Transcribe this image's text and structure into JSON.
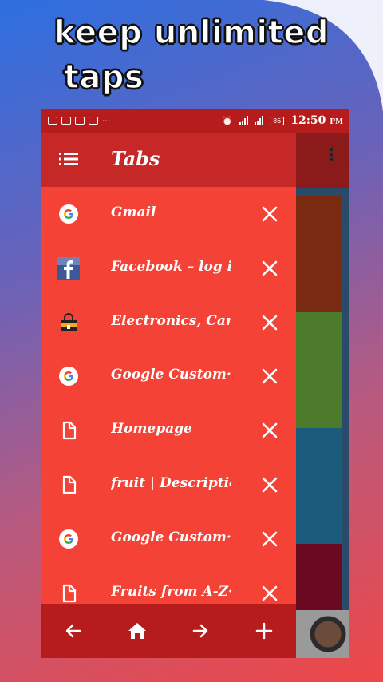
{
  "promo": {
    "headline_line1": "keep unlimited",
    "headline_line2": "taps"
  },
  "status_bar": {
    "time": "12:50",
    "ampm": "PM",
    "battery": "86"
  },
  "drawer": {
    "title": "Tabs",
    "tabs": [
      {
        "title": "Gmail",
        "icon": "google-icon"
      },
      {
        "title": "Facebook – log i···",
        "icon": "facebook-icon"
      },
      {
        "title": "Electronics, Car···",
        "icon": "shopping-bag-icon"
      },
      {
        "title": "Google Custom···",
        "icon": "google-icon"
      },
      {
        "title": "Homepage",
        "icon": "document-icon"
      },
      {
        "title": "fruit | Descriptio···",
        "icon": "document-icon"
      },
      {
        "title": "Google Custom···",
        "icon": "google-icon"
      },
      {
        "title": "Fruits from A-Z···",
        "icon": "document-icon"
      }
    ]
  },
  "colors": {
    "drawer_bg": "#f44336",
    "header_bg": "#c62828",
    "status_bg": "#b71c1c"
  }
}
